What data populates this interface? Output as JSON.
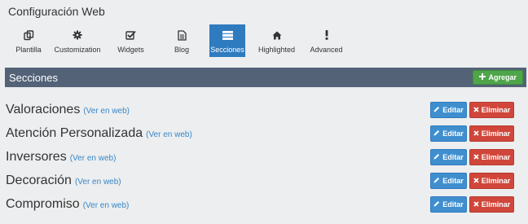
{
  "page": {
    "title": "Configuración Web"
  },
  "tabs": [
    {
      "label": "Plantilla",
      "icon": "copy-icon",
      "active": false
    },
    {
      "label": "Customization",
      "icon": "gear-icon",
      "active": false
    },
    {
      "label": "Widgets",
      "icon": "checkbox-icon",
      "active": false
    },
    {
      "label": "Blog",
      "icon": "document-icon",
      "active": false
    },
    {
      "label": "Secciones",
      "icon": "list-icon",
      "active": true
    },
    {
      "label": "Highlighted",
      "icon": "home-icon",
      "active": false
    },
    {
      "label": "Advanced",
      "icon": "exclamation-icon",
      "active": false
    }
  ],
  "section": {
    "title": "Secciones",
    "add_label": "Agregar",
    "add_icon": "plus-icon"
  },
  "items": [
    {
      "title": "Valoraciones",
      "link": "(Ver en web)",
      "edit_label": "Editar",
      "delete_label": "Eliminar"
    },
    {
      "title": "Atención Personalizada",
      "link": "(Ver en web)",
      "edit_label": "Editar",
      "delete_label": "Eliminar"
    },
    {
      "title": "Inversores",
      "link": "(Ver en web)",
      "edit_label": "Editar",
      "delete_label": "Eliminar"
    },
    {
      "title": "Decoración",
      "link": "(Ver en web)",
      "edit_label": "Editar",
      "delete_label": "Eliminar"
    },
    {
      "title": "Compromiso",
      "link": "(Ver en web)",
      "edit_label": "Editar",
      "delete_label": "Eliminar"
    }
  ],
  "colors": {
    "active_tab": "#2f7bbf",
    "section_bar": "#536277",
    "add_button": "#4fa54a",
    "edit_button": "#3f8fcf",
    "delete_button": "#d0463a",
    "link": "#3a86c8"
  }
}
